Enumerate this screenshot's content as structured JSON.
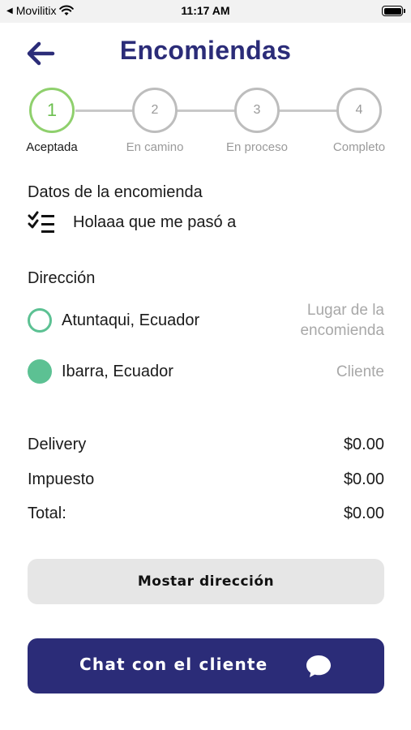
{
  "status_bar": {
    "carrier": "Movilitix",
    "time": "11:17 AM"
  },
  "header": {
    "title": "Encomiendas",
    "back_icon": "arrow-left-icon"
  },
  "stepper": {
    "steps": [
      {
        "number": "1",
        "label": "Aceptada",
        "active": true
      },
      {
        "number": "2",
        "label": "En camino",
        "active": false
      },
      {
        "number": "3",
        "label": "En proceso",
        "active": false
      },
      {
        "number": "4",
        "label": "Completo",
        "active": false
      }
    ],
    "active_color": "#8fd06d",
    "inactive_color": "#bdbdbd"
  },
  "details": {
    "title": "Datos de la encomienda",
    "icon": "checklist-icon",
    "text": "Holaaa que me pasó a"
  },
  "address": {
    "title": "Dirección",
    "items": [
      {
        "name": "Atuntaqui, Ecuador",
        "tag_line1": "Lugar de la",
        "tag_line2": "encomienda",
        "marker": "hollow"
      },
      {
        "name": "Ibarra, Ecuador",
        "tag_line1": "Cliente",
        "tag_line2": "",
        "marker": "filled"
      }
    ],
    "marker_color": "#5cc193"
  },
  "pricing": {
    "rows": [
      {
        "label": "Delivery",
        "value": "$0.00"
      },
      {
        "label": "Impuesto",
        "value": "$0.00"
      },
      {
        "label": "Total:",
        "value": "$0.00"
      }
    ]
  },
  "actions": {
    "show_address_label": "Mostar dirección",
    "chat_label": "Chat con el cliente",
    "chat_icon": "chat-bubble-icon",
    "primary_color": "#2b2c78"
  }
}
